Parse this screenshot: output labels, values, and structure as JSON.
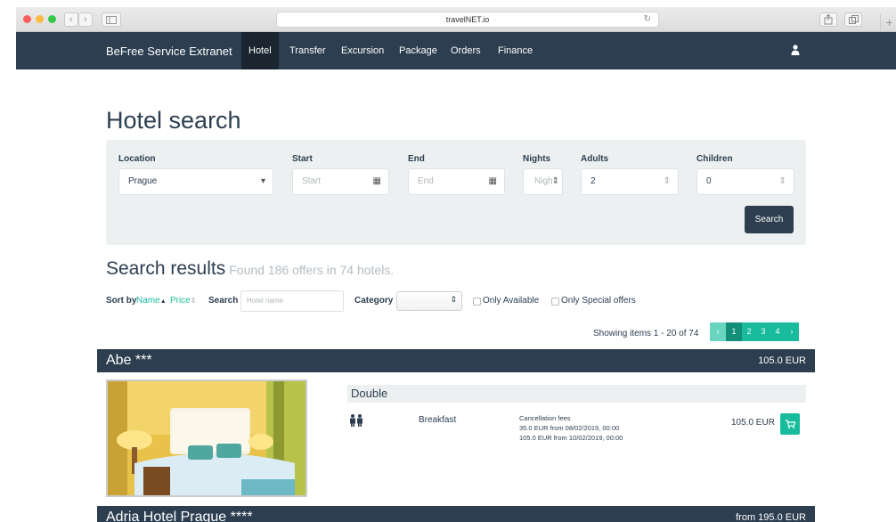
{
  "browser": {
    "url": "travelNET.io",
    "nav_back": "‹",
    "nav_forward": "›",
    "new_tab": "+"
  },
  "navbar": {
    "brand": "BeFree Service Extranet",
    "items": [
      {
        "label": "Hotel",
        "active": true
      },
      {
        "label": "Transfer",
        "active": false
      },
      {
        "label": "Excursion",
        "active": false
      },
      {
        "label": "Package",
        "active": false
      },
      {
        "label": "Orders",
        "active": false
      },
      {
        "label": "Finance",
        "active": false
      }
    ],
    "user_icon": "user-icon"
  },
  "search_form": {
    "title": "Hotel search",
    "location": {
      "label": "Location",
      "value": "Prague"
    },
    "start": {
      "label": "Start",
      "placeholder": "Start"
    },
    "end": {
      "label": "End",
      "placeholder": "End"
    },
    "nights": {
      "label": "Nights",
      "placeholder": "Nigh"
    },
    "adults": {
      "label": "Adults",
      "value": "2"
    },
    "children": {
      "label": "Children",
      "value": "0"
    },
    "search_button": "Search"
  },
  "results": {
    "heading": "Search results",
    "found_text": "Found 186 offers in 74 hotels.",
    "sort_by_label": "Sort by",
    "sort_name": "Name",
    "sort_price": "Price",
    "search_label": "Search",
    "search_placeholder": "Hotel name",
    "category_label": "Category",
    "only_available": "Only Available",
    "only_special": "Only Special offers",
    "showing": "Showing items 1 - 20 of 74",
    "pagination": {
      "prev": "‹",
      "pages": [
        "1",
        "2",
        "3",
        "4"
      ],
      "current": "1",
      "next": "›"
    }
  },
  "hotels": [
    {
      "name": "Abe ***",
      "price": "105.0 EUR",
      "room": {
        "type": "Double",
        "board": "Breakfast",
        "cancellation_title": "Cancellation fees",
        "cancellation_lines": [
          "35.0 EUR from 08/02/2019, 00:00",
          "105.0 EUR from 10/02/2019, 00:00"
        ],
        "price": "105.0 EUR"
      }
    },
    {
      "name": "Adria Hotel Prague ****",
      "price": "from 195.0 EUR"
    }
  ],
  "colors": {
    "navbar": "#2c3e50",
    "accent": "#18bc9c",
    "panel": "#ecf0f1"
  }
}
